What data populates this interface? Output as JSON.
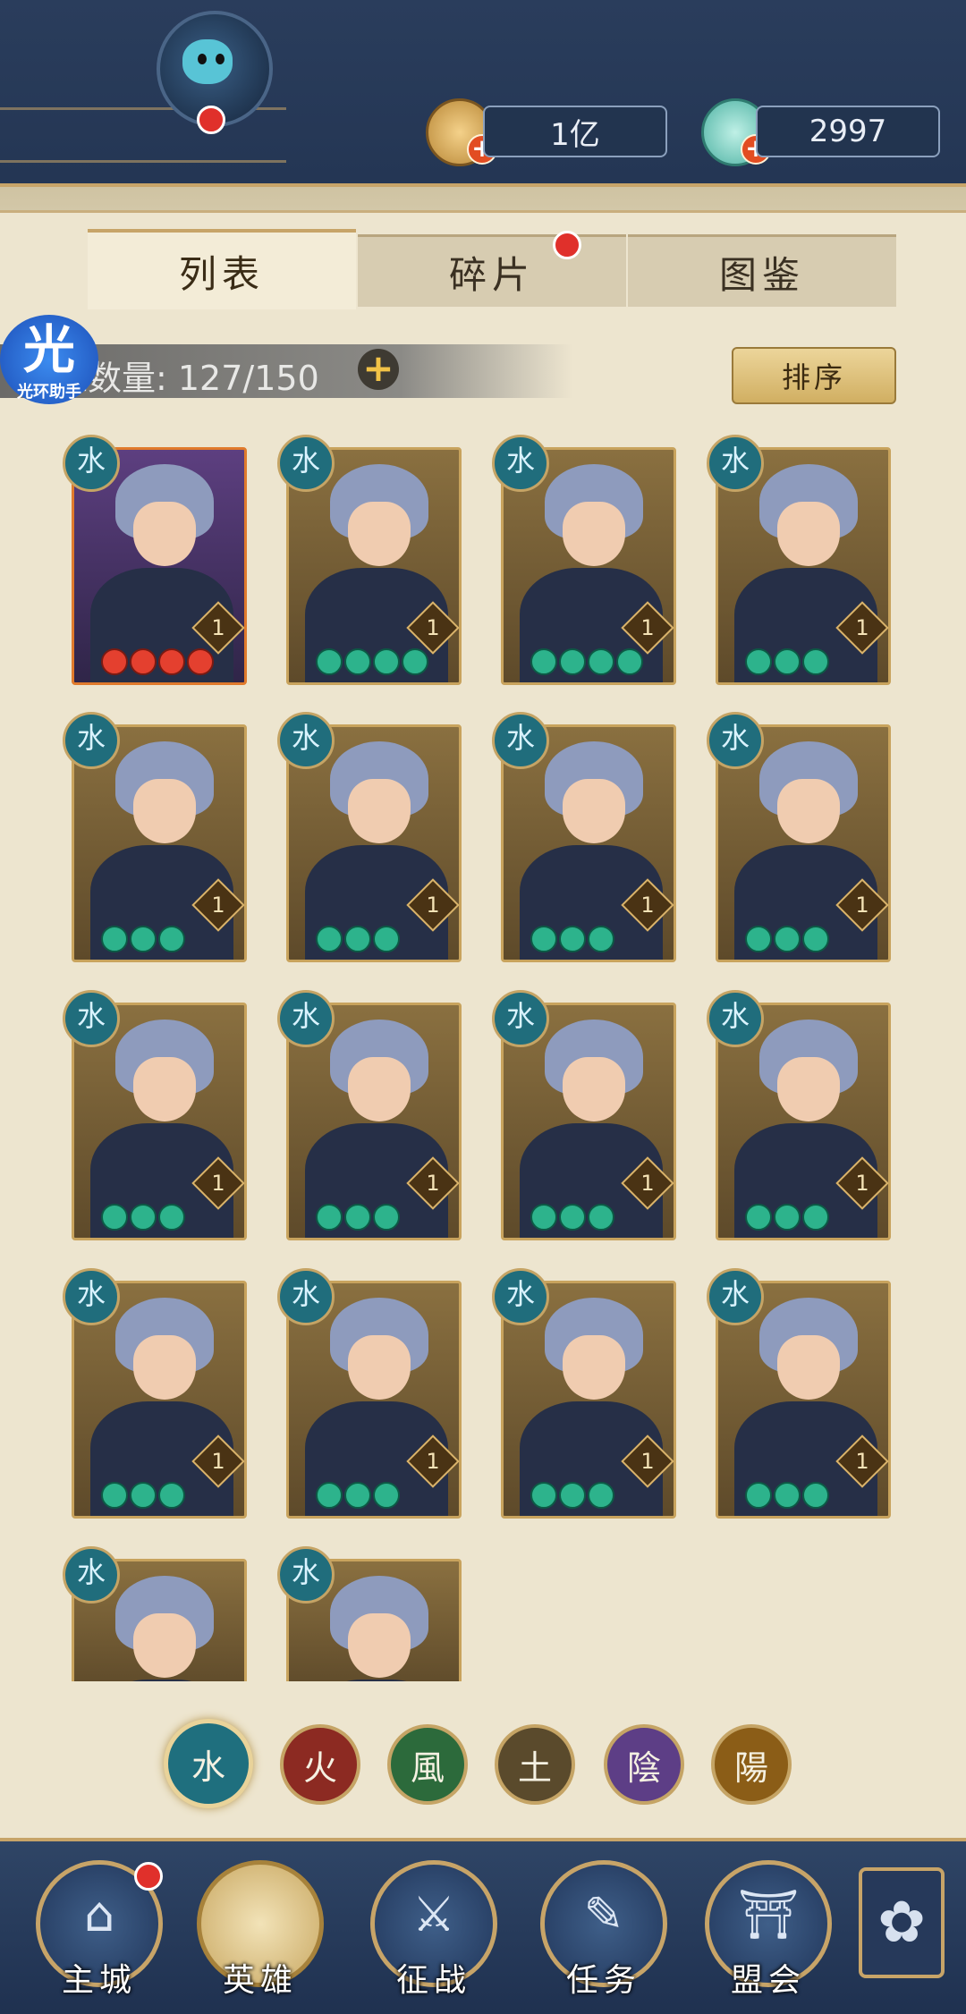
{
  "currency": {
    "gold": {
      "value": "1亿",
      "icon": "gold-coin-icon"
    },
    "jade": {
      "value": "2997",
      "icon": "jade-ingot-icon"
    }
  },
  "tabs": [
    {
      "label": "列表",
      "active": true
    },
    {
      "label": "碎片",
      "active": false,
      "badge": true
    },
    {
      "label": "图鉴",
      "active": false
    }
  ],
  "hero_count": {
    "text": "雄数量: 127/150"
  },
  "helper": {
    "glyph": "光",
    "label": "光环助手"
  },
  "sort_button": {
    "label": "排序"
  },
  "element_glyph": "水",
  "heroes": [
    {
      "level": "1",
      "stars": 4,
      "star_color": "red",
      "rarity": "orange"
    },
    {
      "level": "1",
      "stars": 4,
      "star_color": "green"
    },
    {
      "level": "1",
      "stars": 4,
      "star_color": "green"
    },
    {
      "level": "1",
      "stars": 3,
      "star_color": "green"
    },
    {
      "level": "1",
      "stars": 3,
      "star_color": "green"
    },
    {
      "level": "1",
      "stars": 3,
      "star_color": "green"
    },
    {
      "level": "1",
      "stars": 3,
      "star_color": "green"
    },
    {
      "level": "1",
      "stars": 3,
      "star_color": "green"
    },
    {
      "level": "1",
      "stars": 3,
      "star_color": "green"
    },
    {
      "level": "1",
      "stars": 3,
      "star_color": "green"
    },
    {
      "level": "1",
      "stars": 3,
      "star_color": "green"
    },
    {
      "level": "1",
      "stars": 3,
      "star_color": "green"
    },
    {
      "level": "1",
      "stars": 3,
      "star_color": "green"
    },
    {
      "level": "1",
      "stars": 3,
      "star_color": "green"
    },
    {
      "level": "1",
      "stars": 3,
      "star_color": "green"
    },
    {
      "level": "1",
      "stars": 3,
      "star_color": "green"
    },
    {
      "level": "",
      "stars": 0,
      "star_color": "green"
    },
    {
      "level": "",
      "stars": 0,
      "star_color": "green"
    }
  ],
  "filters": [
    {
      "glyph": "水",
      "color": "#1f6f7e",
      "selected": true
    },
    {
      "glyph": "火",
      "color": "#8c2a22",
      "selected": false
    },
    {
      "glyph": "風",
      "color": "#2c6a3b",
      "selected": false
    },
    {
      "glyph": "土",
      "color": "#5a4a2c",
      "selected": false
    },
    {
      "glyph": "陰",
      "color": "#5d3e86",
      "selected": false
    },
    {
      "glyph": "陽",
      "color": "#8b5d17",
      "selected": false
    }
  ],
  "nav": [
    {
      "label": "主城",
      "glyph": "⌂",
      "badge": true,
      "active": false
    },
    {
      "label": "英雄",
      "glyph": "",
      "badge": false,
      "active": true
    },
    {
      "label": "征战",
      "glyph": "⚔",
      "badge": false,
      "active": false
    },
    {
      "label": "任务",
      "glyph": "✎",
      "badge": false,
      "active": false
    },
    {
      "label": "盟会",
      "glyph": "⛩",
      "badge": false,
      "active": false
    }
  ],
  "more_icon": "clover-icon"
}
